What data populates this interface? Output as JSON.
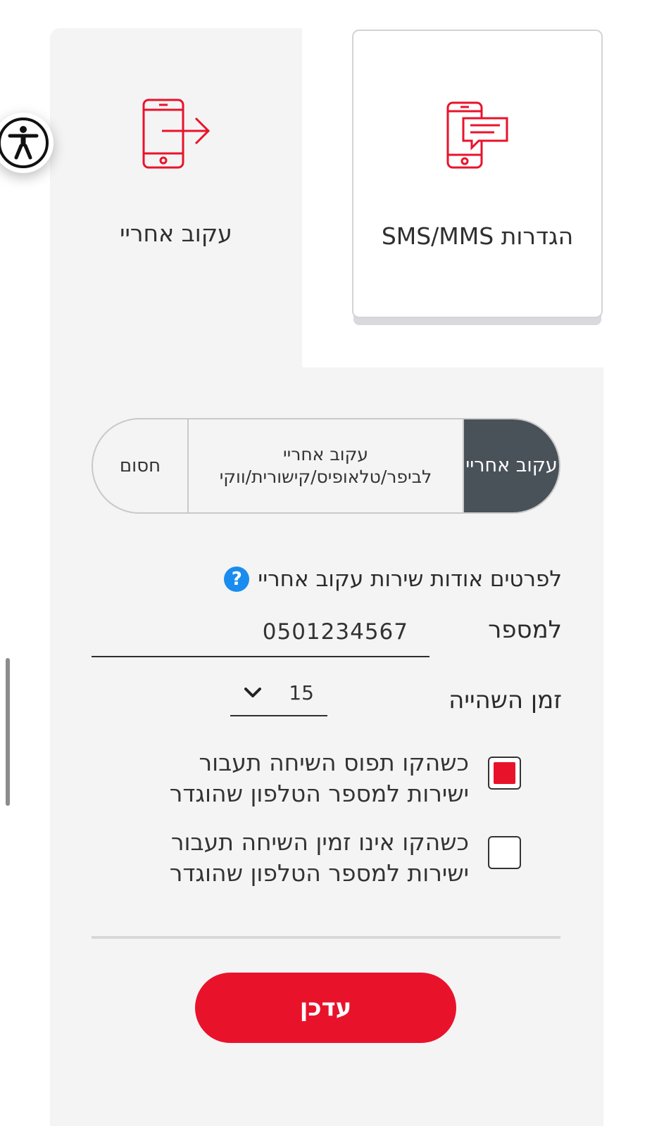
{
  "tiles": [
    {
      "label": "הגדרות SMS/MMS",
      "icon": "phone-chat-icon",
      "selected": true
    },
    {
      "label": "עקוב אחריי",
      "icon": "phone-forward-icon",
      "selected": false
    }
  ],
  "accessibility": {
    "icon": "accessibility-icon"
  },
  "segments": {
    "active": "עקוב אחריי",
    "middle_line1": "עקוב אחריי",
    "middle_line2": "לביפר/טלאופיס/קישורית/ווקי",
    "block": "חסום"
  },
  "info": {
    "text": "לפרטים אודות שירות עקוב אחריי",
    "help_icon": "?"
  },
  "form": {
    "number_label": "למספר",
    "number_value": "0501234567",
    "delay_label": "זמן השהייה",
    "delay_value": "15"
  },
  "options": [
    {
      "line1": "כשהקו תפוס השיחה תעבור",
      "line2": "ישירות למספר הטלפון שהוגדר",
      "checked": true
    },
    {
      "line1": "כשהקו אינו זמין השיחה תעבור",
      "line2": "ישירות למספר הטלפון שהוגדר",
      "checked": false
    }
  ],
  "submit": {
    "label": "עדכן"
  },
  "colors": {
    "accent": "#e8132b",
    "dark_segment": "#4a5259",
    "help_blue": "#1a8cf0",
    "panel": "#f4f4f4"
  }
}
